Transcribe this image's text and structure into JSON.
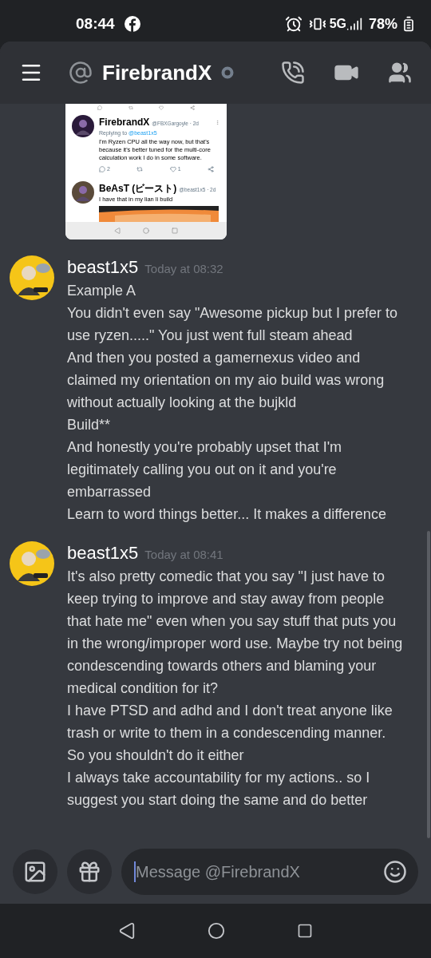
{
  "status_bar": {
    "time": "08:44",
    "network": "5G",
    "battery": "78%"
  },
  "header": {
    "title": "FirebrandX"
  },
  "embedded_screenshot": {
    "tweets": [
      {
        "name": "FirebrandX",
        "handle": "@FBXGargoyle · 2d",
        "replying_label": "Replying to",
        "replying_to": "@beast1x5",
        "text": "I'm Ryzen CPU all the way now, but that's because it's better tuned for the multi-core calculation work I do in some software.",
        "reply_count": "2",
        "like_count": "1"
      },
      {
        "name": "BeAsT (ビースト)",
        "handle": "@beast1x5 · 2d",
        "text": "I have that in my lian li build"
      }
    ]
  },
  "messages": [
    {
      "author": "beast1x5",
      "timestamp": "Today at 08:32",
      "lines": [
        "Example A",
        "You didn't even say \"Awesome pickup but I prefer to use ryzen.....\" You just went full steam ahead",
        "And then you posted a gamernexus video and claimed my orientation on my aio build was wrong without actually looking at the bujkld",
        "Build**",
        "And honestly you're probably upset that I'm legitimately calling you out on it and you're embarrassed",
        "Learn to word things better... It makes a difference"
      ]
    },
    {
      "author": "beast1x5",
      "timestamp": "Today at 08:41",
      "lines": [
        "It's also pretty comedic that you say \"I just have to keep trying to improve and stay away from people that hate me\" even when you say stuff that puts you in the wrong/improper word use. Maybe try not being condescending towards others and blaming your medical condition for it?",
        "I have PTSD and adhd and I don't treat anyone like trash or write to them in a condescending manner. So you shouldn't do it either",
        "I always take accountability for my actions.. so I suggest you start doing the same and do better"
      ]
    }
  ],
  "composer": {
    "placeholder": "Message @FirebrandX"
  }
}
